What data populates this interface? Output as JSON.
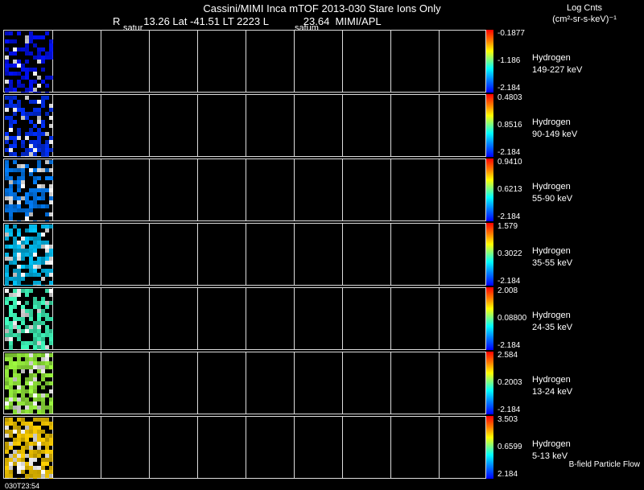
{
  "header": {
    "title": "Cassini/MIMI Inca mTOF  2013-030   Stare   Ions Only",
    "subtitle": "R        13.26 Lat -41.51 LT 2223 L            23.64  MIMI/APL",
    "note_left": "satur",
    "note_right": "satum",
    "units_line1": "Log Cnts",
    "units_line2": "(cm²-sr-s-keV)⁻¹"
  },
  "panels": [
    {
      "species": "Hydrogen",
      "energy": "149-227 keV",
      "max": "-0.1877",
      "mid": "-1.186",
      "min": "-2.184",
      "base": "#0010ff"
    },
    {
      "species": "Hydrogen",
      "energy": "90-149 keV",
      "max": "0.4803",
      "mid": "0.8516",
      "min": "-2.184",
      "base": "#0030ff"
    },
    {
      "species": "Hydrogen",
      "energy": "55-90 keV",
      "max": "0.9410",
      "mid": "0.6213",
      "min": "-2.184",
      "base": "#0080ff"
    },
    {
      "species": "Hydrogen",
      "energy": "35-55 keV",
      "max": "1.579",
      "mid": "0.3022",
      "min": "-2.184",
      "base": "#00c8ff"
    },
    {
      "species": "Hydrogen",
      "energy": "24-35 keV",
      "max": "2.008",
      "mid": "0.08800",
      "min": "-2.184",
      "base": "#40ffc0"
    },
    {
      "species": "Hydrogen",
      "energy": "13-24 keV",
      "max": "2.584",
      "mid": "0.2003",
      "min": "-2.184",
      "base": "#a0ff40"
    },
    {
      "species": "Hydrogen",
      "energy": "5-13 keV",
      "max": "3.503",
      "mid": "0.6599",
      "min": "2.184",
      "base": "#ffd000"
    }
  ],
  "footer": {
    "time": "030T23:54",
    "flow": "B-field Particle Flow"
  }
}
